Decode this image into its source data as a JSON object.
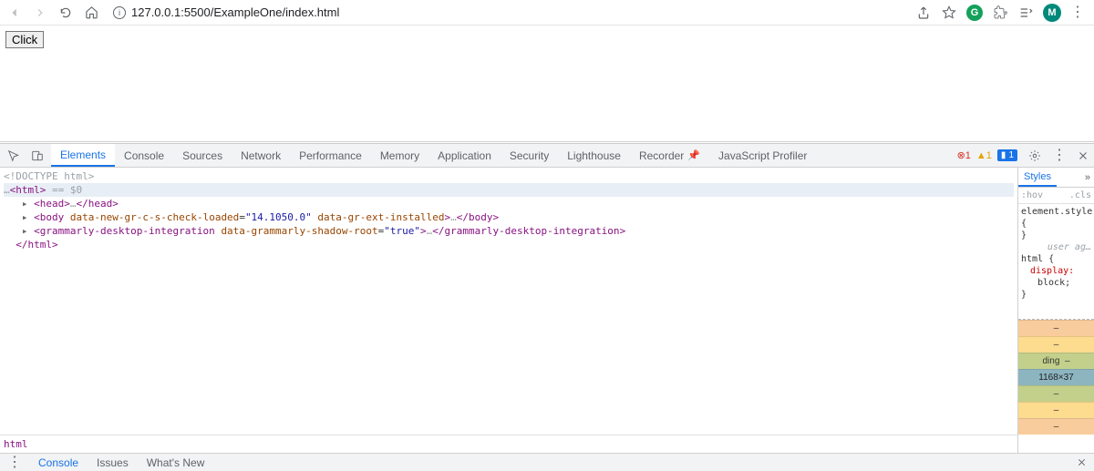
{
  "browser": {
    "url": "127.0.0.1:5500/ExampleOne/index.html",
    "avatar_letter": "M",
    "ext_letter": "G"
  },
  "page": {
    "button_label": "Click"
  },
  "devtools": {
    "tabs": {
      "elements": "Elements",
      "console": "Console",
      "sources": "Sources",
      "network": "Network",
      "performance": "Performance",
      "memory": "Memory",
      "application": "Application",
      "security": "Security",
      "lighthouse": "Lighthouse",
      "recorder": "Recorder",
      "jsprofiler": "JavaScript Profiler"
    },
    "errors": "1",
    "warnings": "1",
    "issues": "1",
    "styles_tab": "Styles",
    "filter_hov": ":hov",
    "filter_cls": ".cls",
    "rule_element": "element.style {",
    "rule_element_close": "}",
    "ua_label": "user ag…",
    "rule_html": "html {",
    "rule_display": "display:",
    "rule_block": "block;",
    "rule_html_close": "}",
    "boxmodel_padding_label": "ding",
    "boxmodel_content": "1168×37",
    "crumb": "html",
    "drawer_console": "Console",
    "drawer_issues": "Issues",
    "drawer_whatsnew": "What's New"
  },
  "dom": {
    "l1": "<!DOCTYPE html>",
    "l2_open": "<html>",
    "l2_annot": " == $0",
    "l3": "  ▸ <head>…</head>",
    "l4": "  ▸ <body data-new-gr-c-s-check-loaded=\"14.1050.0\" data-gr-ext-installed>…</body>",
    "l5": "  ▸ <grammarly-desktop-integration data-grammarly-shadow-root=\"true\">…</grammarly-desktop-integration>",
    "l6": "  </html>",
    "ellipsis": "…"
  }
}
